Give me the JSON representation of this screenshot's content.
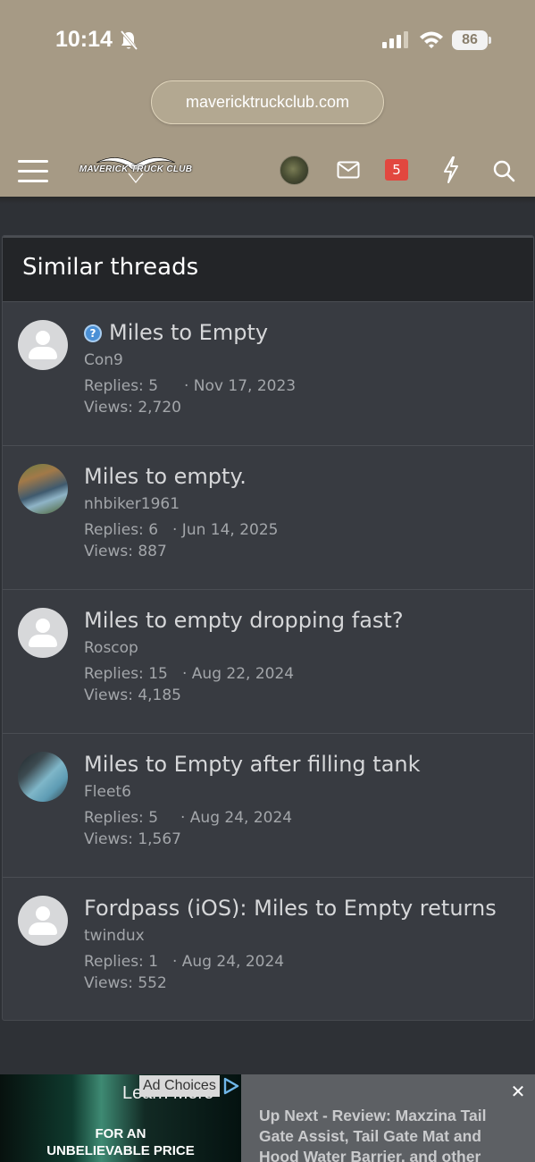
{
  "status_bar": {
    "time": "10:14",
    "battery": "86"
  },
  "browser": {
    "url": "mavericktruckclub.com"
  },
  "header": {
    "logo_text": "MAVERICK TRUCK CLUB",
    "alerts_count": "5"
  },
  "similar_threads": {
    "title": "Similar threads",
    "threads": [
      {
        "title": "Miles to Empty",
        "has_question_badge": true,
        "author": "Con9",
        "replies": "Replies: 5",
        "date": "· Nov 17, 2023",
        "views": "Views: 2,720",
        "avatar": "default"
      },
      {
        "title": "Miles to empty.",
        "author": "nhbiker1961",
        "replies": "Replies: 6",
        "date": "· Jun 14, 2025",
        "views": "Views: 887",
        "avatar": "photo"
      },
      {
        "title": "Miles to empty dropping fast?",
        "author": "Roscop",
        "replies": "Replies: 15",
        "date": "· Aug 22, 2024",
        "views": "Views: 4,185",
        "avatar": "default"
      },
      {
        "title": "Miles to Empty after filling tank",
        "author": "Fleet6",
        "replies": "Replies: 5",
        "date": "· Aug 24, 2024",
        "views": "Views: 1,567",
        "avatar": "photo"
      },
      {
        "title": "Fordpass (iOS): Miles to Empty returns",
        "author": "twindux",
        "replies": "Replies: 1",
        "date": "· Aug 24, 2024",
        "views": "Views: 552",
        "avatar": "default"
      }
    ]
  },
  "ad": {
    "learn_more": "Learn More",
    "ad_choices": "Ad Choices",
    "price_line1": "FOR AN",
    "price_line2": "UNBELIEVABLE PRICE",
    "up_next": "Up Next - Review: Maxzina Tail Gate Assist, Tail Gate Mat and Hood Water Barrier, and other"
  },
  "colors": {
    "header_bg": "#a69a85",
    "page_bg": "#2e3136",
    "panel_bg": "#383b41",
    "badge_red": "#e2473f"
  }
}
